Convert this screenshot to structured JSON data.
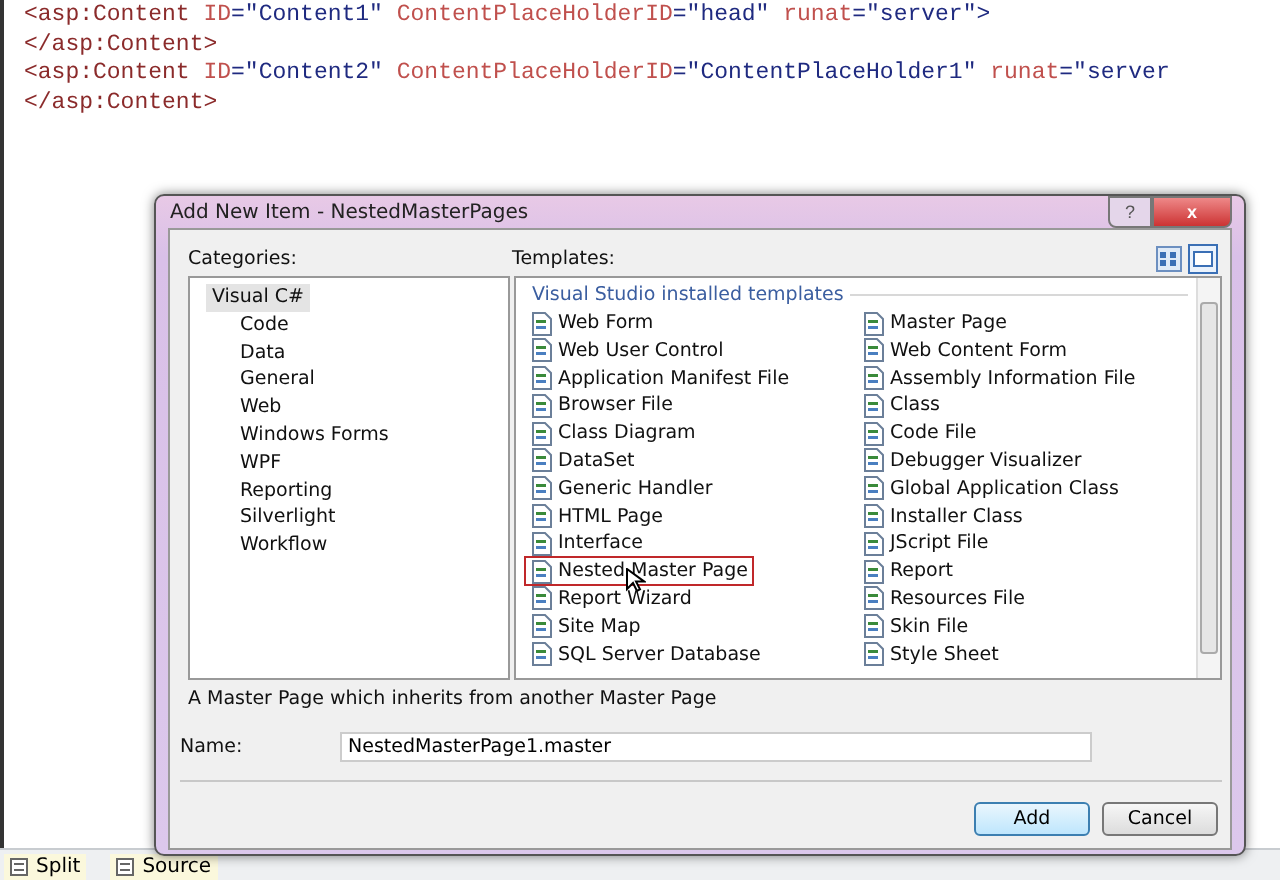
{
  "editor": {
    "lines": [
      [
        {
          "kind": "tag",
          "text": "<asp:Content "
        },
        {
          "kind": "attr",
          "text": "ID"
        },
        {
          "kind": "value",
          "text": "=\"Content1\" "
        },
        {
          "kind": "attr",
          "text": "ContentPlaceHolderID"
        },
        {
          "kind": "value",
          "text": "=\"head\" "
        },
        {
          "kind": "attr",
          "text": "runat"
        },
        {
          "kind": "value",
          "text": "=\"server\">"
        }
      ],
      [
        {
          "kind": "tag",
          "text": "</asp:Content>"
        }
      ],
      [
        {
          "kind": "tag",
          "text": "<asp:Content "
        },
        {
          "kind": "attr",
          "text": "ID"
        },
        {
          "kind": "value",
          "text": "=\"Content2\" "
        },
        {
          "kind": "attr",
          "text": "ContentPlaceHolderID"
        },
        {
          "kind": "value",
          "text": "=\"ContentPlaceHolder1\" "
        },
        {
          "kind": "attr",
          "text": "runat"
        },
        {
          "kind": "value",
          "text": "=\"server"
        }
      ],
      [
        {
          "kind": "tag",
          "text": "</asp:Content>"
        }
      ]
    ]
  },
  "dialog": {
    "title": "Add New Item - NestedMasterPages",
    "help_button": "?",
    "close_button": "x",
    "categories_label": "Categories:",
    "categories": [
      {
        "label": "Visual C#",
        "selected": true,
        "children": [
          {
            "label": "Code",
            "selected": false
          },
          {
            "label": "Data",
            "selected": false
          },
          {
            "label": "General",
            "selected": false
          },
          {
            "label": "Web",
            "selected": false
          },
          {
            "label": "Windows Forms",
            "selected": false
          },
          {
            "label": "WPF",
            "selected": false
          },
          {
            "label": "Reporting",
            "selected": false
          },
          {
            "label": "Silverlight",
            "selected": false
          },
          {
            "label": "Workflow",
            "selected": false
          }
        ]
      }
    ],
    "templates_label": "Templates:",
    "group_heading": "Visual Studio installed templates",
    "templates": [
      {
        "label": "Web Form",
        "selected": false
      },
      {
        "label": "Web User Control",
        "selected": false
      },
      {
        "label": "Application Manifest File",
        "selected": false
      },
      {
        "label": "Browser File",
        "selected": false
      },
      {
        "label": "Class Diagram",
        "selected": false
      },
      {
        "label": "DataSet",
        "selected": false
      },
      {
        "label": "Generic Handler",
        "selected": false
      },
      {
        "label": "HTML Page",
        "selected": false
      },
      {
        "label": "Interface",
        "selected": false
      },
      {
        "label": "Nested Master Page",
        "selected": true
      },
      {
        "label": "Report Wizard",
        "selected": false
      },
      {
        "label": "Site Map",
        "selected": false
      },
      {
        "label": "SQL Server Database",
        "selected": false
      },
      {
        "label": "Master Page",
        "selected": false
      },
      {
        "label": "Web Content Form",
        "selected": false
      },
      {
        "label": "Assembly Information File",
        "selected": false
      },
      {
        "label": "Class",
        "selected": false
      },
      {
        "label": "Code File",
        "selected": false
      },
      {
        "label": "Debugger Visualizer",
        "selected": false
      },
      {
        "label": "Global Application Class",
        "selected": false
      },
      {
        "label": "Installer Class",
        "selected": false
      },
      {
        "label": "JScript File",
        "selected": false
      },
      {
        "label": "Report",
        "selected": false
      },
      {
        "label": "Resources File",
        "selected": false
      },
      {
        "label": "Skin File",
        "selected": false
      },
      {
        "label": "Style Sheet",
        "selected": false
      }
    ],
    "description": "A Master Page which inherits from another Master Page",
    "name_label": "Name:",
    "name_value": "NestedMasterPage1.master",
    "buttons": [
      {
        "label": "Add",
        "default": true
      },
      {
        "label": "Cancel",
        "default": false
      }
    ]
  },
  "view_tabs": [
    {
      "label": "Split"
    },
    {
      "label": "Source"
    }
  ]
}
